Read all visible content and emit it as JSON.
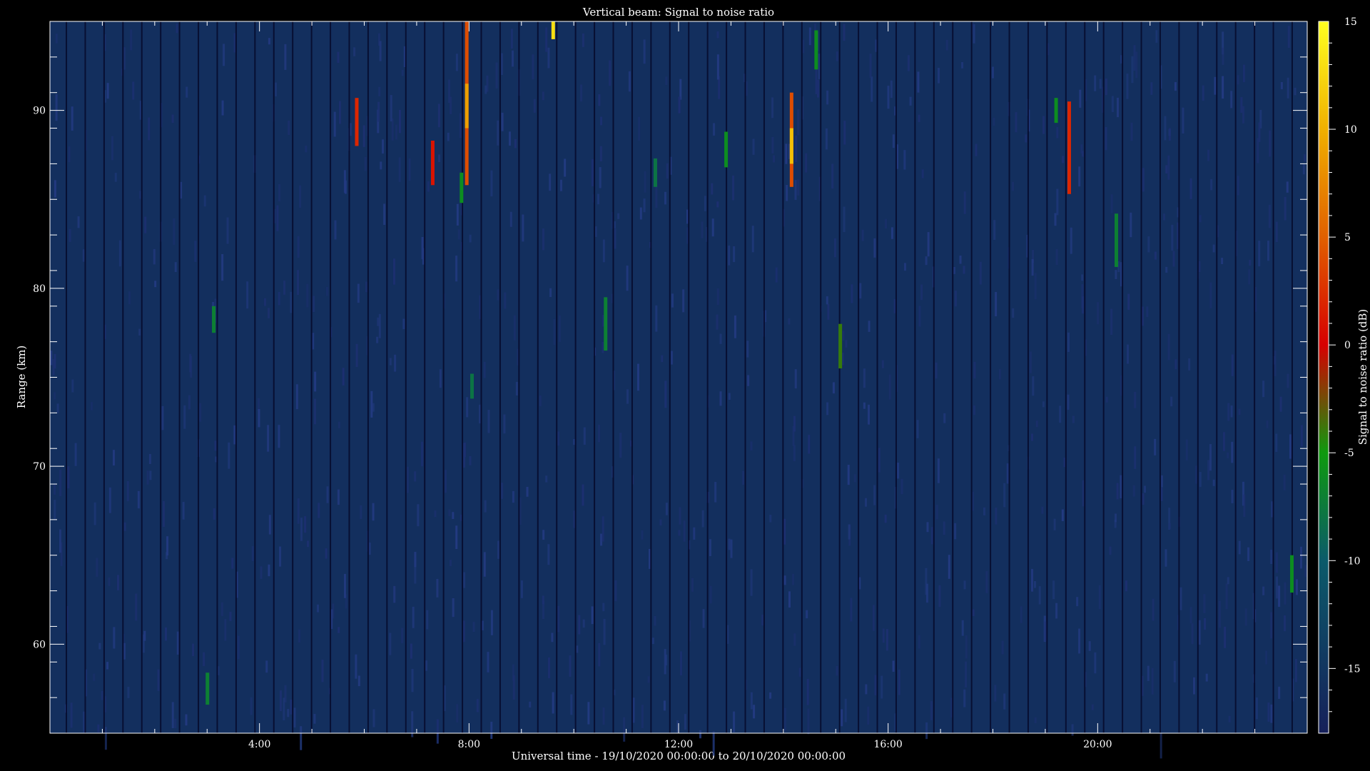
{
  "chart_data": {
    "type": "heatmap",
    "title": "Vertical beam: Signal to noise ratio",
    "xlabel": "Universal time - 19/10/2020 00:00:00 to 20/10/2020 00:00:00",
    "ylabel": "Range (km)",
    "colorbar_label": "Signal to noise ratio (dB)",
    "x_range_hours": [
      0,
      24
    ],
    "y_range_km": [
      55,
      95
    ],
    "z_range_db": [
      -18,
      15
    ],
    "x_ticks": [
      {
        "value": 4,
        "label": "4:00"
      },
      {
        "value": 8,
        "label": "8:00"
      },
      {
        "value": 12,
        "label": "12:00"
      },
      {
        "value": 16,
        "label": "16:00"
      },
      {
        "value": 20,
        "label": "20:00"
      }
    ],
    "y_ticks": [
      {
        "value": 60,
        "label": "60"
      },
      {
        "value": 70,
        "label": "70"
      },
      {
        "value": 80,
        "label": "80"
      },
      {
        "value": 90,
        "label": "90"
      }
    ],
    "colorbar_ticks": [
      {
        "value": 15,
        "label": "15"
      },
      {
        "value": 10,
        "label": "10"
      },
      {
        "value": 5,
        "label": "5"
      },
      {
        "value": 0,
        "label": "0"
      },
      {
        "value": -5,
        "label": "-5"
      },
      {
        "value": -10,
        "label": "-10"
      },
      {
        "value": -15,
        "label": "-15"
      }
    ],
    "background_db": -16,
    "colorscale": [
      {
        "db": -18,
        "color": "#16205a"
      },
      {
        "db": -10,
        "color": "#0b5a6a"
      },
      {
        "db": -5,
        "color": "#0e9a0e"
      },
      {
        "db": 0,
        "color": "#d70000"
      },
      {
        "db": 5,
        "color": "#e06000"
      },
      {
        "db": 10,
        "color": "#f0b000"
      },
      {
        "db": 15,
        "color": "#ffff20"
      }
    ],
    "echoes": [
      {
        "t": 3.12,
        "r0": 77.5,
        "r1": 79.0,
        "db": -7
      },
      {
        "t": 3.0,
        "r0": 56.6,
        "r1": 58.4,
        "db": -7
      },
      {
        "t": 5.85,
        "r0": 88.0,
        "r1": 90.7,
        "db": 2
      },
      {
        "t": 7.3,
        "r0": 85.8,
        "r1": 88.3,
        "db": 1
      },
      {
        "t": 7.85,
        "r0": 84.8,
        "r1": 86.5,
        "db": -6
      },
      {
        "t": 7.95,
        "r0": 85.8,
        "r1": 95.0,
        "db": 4
      },
      {
        "t": 7.95,
        "r0": 89.0,
        "r1": 91.5,
        "db": 9
      },
      {
        "t": 8.05,
        "r0": 73.8,
        "r1": 75.2,
        "db": -8
      },
      {
        "t": 9.6,
        "r0": 94.0,
        "r1": 95.0,
        "db": 13
      },
      {
        "t": 10.6,
        "r0": 76.5,
        "r1": 79.5,
        "db": -7
      },
      {
        "t": 11.55,
        "r0": 85.7,
        "r1": 87.3,
        "db": -8
      },
      {
        "t": 12.9,
        "r0": 86.8,
        "r1": 88.8,
        "db": -6
      },
      {
        "t": 14.15,
        "r0": 85.7,
        "r1": 91.0,
        "db": 4
      },
      {
        "t": 14.15,
        "r0": 87.0,
        "r1": 89.0,
        "db": 11
      },
      {
        "t": 14.62,
        "r0": 92.3,
        "r1": 94.5,
        "db": -6
      },
      {
        "t": 15.08,
        "r0": 75.5,
        "r1": 78.0,
        "db": -4
      },
      {
        "t": 19.2,
        "r0": 89.3,
        "r1": 90.7,
        "db": -6
      },
      {
        "t": 19.45,
        "r0": 85.3,
        "r1": 90.5,
        "db": 2
      },
      {
        "t": 20.35,
        "r0": 81.2,
        "r1": 84.2,
        "db": -7
      },
      {
        "t": 23.7,
        "r0": 62.9,
        "r1": 65.0,
        "db": -6
      }
    ]
  }
}
